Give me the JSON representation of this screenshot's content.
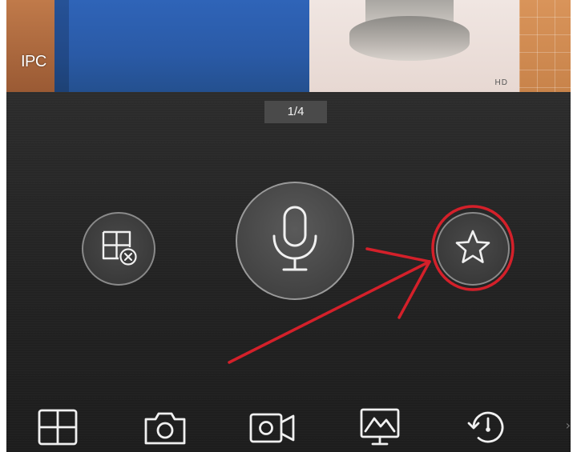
{
  "video": {
    "channel_label": "IPC",
    "watermark": "HD"
  },
  "panel": {
    "page_indicator": "1/4"
  },
  "controls": [
    {
      "id": "close-window",
      "icon": "grid-close-icon"
    },
    {
      "id": "talk",
      "icon": "microphone-icon"
    },
    {
      "id": "favorite",
      "icon": "star-icon"
    }
  ],
  "annotation": {
    "highlight_color": "#d4202a"
  },
  "toolbar": {
    "items": [
      {
        "icon": "split-screen-icon"
      },
      {
        "icon": "camera-icon"
      },
      {
        "icon": "video-record-icon"
      },
      {
        "icon": "image-quality-icon"
      },
      {
        "icon": "playback-icon"
      }
    ],
    "more": "›"
  },
  "colors": {
    "panel_bg": "#222222",
    "icon": "#f0f0f0",
    "indicator_bg": "#4a4a4a"
  }
}
